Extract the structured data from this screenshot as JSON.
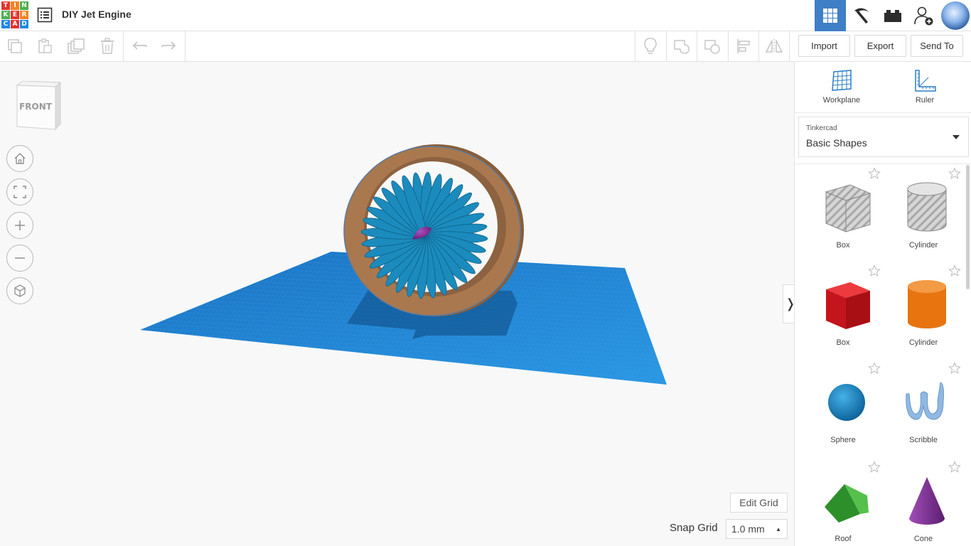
{
  "app": {
    "logo_letters": [
      "T",
      "I",
      "N",
      "K",
      "E",
      "R",
      "C",
      "A",
      "D"
    ],
    "logo_colors": [
      "#e3342f",
      "#f58220",
      "#4caf50",
      "#4caf50",
      "#e3342f",
      "#f58220",
      "#1e88e5",
      "#e3342f",
      "#1e88e5"
    ],
    "design_title": "DIY Jet Engine"
  },
  "topbar_icons": [
    "grid-view-icon",
    "pickaxe-icon",
    "brick-icon",
    "add-user-icon",
    "avatar"
  ],
  "toolbar": {
    "import_label": "Import",
    "export_label": "Export",
    "sendto_label": "Send To"
  },
  "viewcube": {
    "face_label": "FRONT"
  },
  "viewport": {
    "edit_grid_label": "Edit Grid",
    "snap_grid_label": "Snap Grid",
    "snap_grid_value": "1.0 mm",
    "collapse_glyph": "❭"
  },
  "panel": {
    "workplane_label": "Workplane",
    "ruler_label": "Ruler",
    "library_source": "Tinkercad",
    "library_name": "Basic Shapes",
    "shapes": [
      {
        "name": "Box",
        "kind": "box-hole",
        "color": "#b8b8b8"
      },
      {
        "name": "Cylinder",
        "kind": "cylinder-hole",
        "color": "#c0c0c0"
      },
      {
        "name": "Box",
        "kind": "box",
        "color": "#d91e26"
      },
      {
        "name": "Cylinder",
        "kind": "cylinder",
        "color": "#e87410"
      },
      {
        "name": "Sphere",
        "kind": "sphere",
        "color": "#1585c5"
      },
      {
        "name": "Scribble",
        "kind": "scribble",
        "color": "#8fb8e2"
      },
      {
        "name": "Roof",
        "kind": "roof",
        "color": "#3aa535"
      },
      {
        "name": "Cone",
        "kind": "cone",
        "color": "#7a2e8e"
      }
    ]
  },
  "scene": {
    "workplane_color": "#1e88d8",
    "ring_color": "#a9784e",
    "blade_color": "#1b8bbd",
    "spinner_color": "#7b2d8b"
  }
}
